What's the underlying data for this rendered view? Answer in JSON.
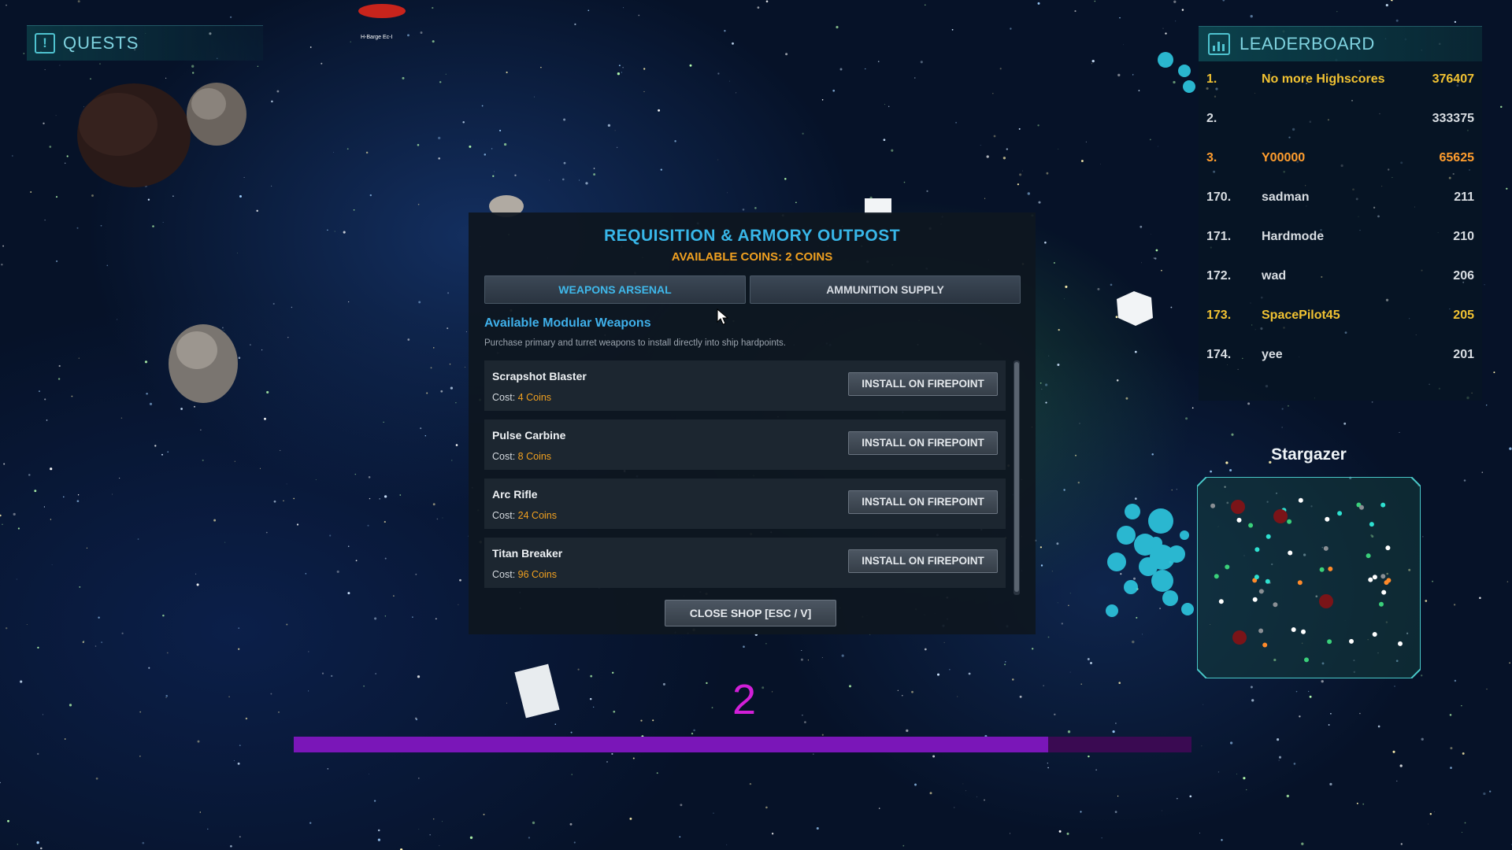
{
  "quests": {
    "title": "QUESTS",
    "icon": "exclamation-icon"
  },
  "player_tag": "H-Barge Ec-I",
  "leaderboard": {
    "title": "LEADERBOARD",
    "icon": "bar-chart-icon",
    "rows": [
      {
        "rank": "1.",
        "name": "No more Highscores",
        "score": "376407",
        "color": "#f1c232"
      },
      {
        "rank": "2.",
        "name": "",
        "score": "333375",
        "color": "#d8dde2"
      },
      {
        "rank": "3.",
        "name": "Y00000",
        "score": "65625",
        "color": "#ff9d2e"
      },
      {
        "rank": "170.",
        "name": "sadman",
        "score": "211",
        "color": "#d8dde2"
      },
      {
        "rank": "171.",
        "name": "Hardmode",
        "score": "210",
        "color": "#d8dde2"
      },
      {
        "rank": "172.",
        "name": "wad",
        "score": "206",
        "color": "#d8dde2"
      },
      {
        "rank": "173.",
        "name": "SpacePilot45",
        "score": "205",
        "color": "#f1c232"
      },
      {
        "rank": "174.",
        "name": "yee",
        "score": "201",
        "color": "#d8dde2"
      }
    ]
  },
  "minimap": {
    "name": "Stargazer"
  },
  "shop": {
    "title": "REQUISITION & ARMORY OUTPOST",
    "coins": "AVAILABLE COINS: 2 COINS",
    "tabs": {
      "weapons": "WEAPONS ARSENAL",
      "ammo": "AMMUNITION SUPPLY"
    },
    "active_tab": "weapons",
    "section_title": "Available Modular Weapons",
    "section_desc": "Purchase primary and turret weapons to install directly into ship hardpoints.",
    "cost_prefix": "Cost:",
    "items": [
      {
        "name": "Scrapshot Blaster",
        "cost": "4 Coins",
        "button": "INSTALL ON FIREPOINT"
      },
      {
        "name": "Pulse Carbine",
        "cost": "8 Coins",
        "button": "INSTALL ON FIREPOINT"
      },
      {
        "name": "Arc Rifle",
        "cost": "24 Coins",
        "button": "INSTALL ON FIREPOINT"
      },
      {
        "name": "Titan Breaker",
        "cost": "96 Coins",
        "button": "INSTALL ON FIREPOINT"
      }
    ],
    "close_label": "CLOSE SHOP [ESC / V]"
  },
  "level": "2",
  "xp_progress": 0.84,
  "colors": {
    "accent": "#38b6e8",
    "coins": "#f0a020",
    "xp": "#7a16b8",
    "level": "#d21fd8"
  }
}
